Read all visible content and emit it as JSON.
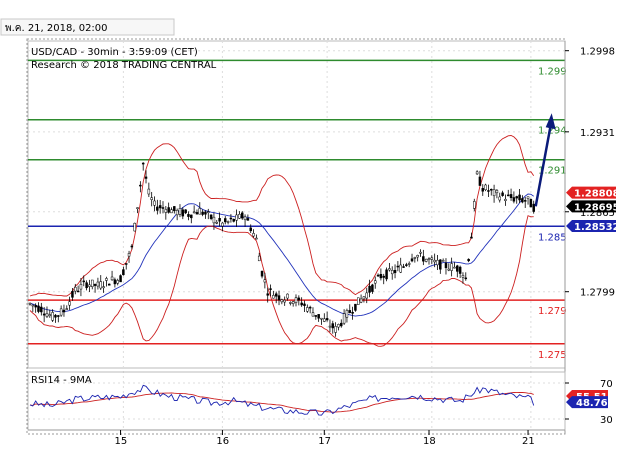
{
  "header": {
    "date_label": "พ.ค. 21, 2018, 02:00"
  },
  "chart_data": {
    "type": "candlestick",
    "title": "USD/CAD - 30min - 3:59:09 (CET)",
    "subtitle": "Research © 2018 TRADING CENTRAL",
    "x_ticks": [
      "15",
      "16",
      "17",
      "18",
      "21"
    ],
    "y_ticks": [
      1.2998,
      1.2931,
      1.2865,
      1.2799
    ],
    "ylim": [
      1.2736,
      1.3006
    ],
    "price_tags": {
      "upper": 1.28808,
      "current": 1.28695,
      "lower": 1.28532
    },
    "levels": [
      {
        "label": "1.299",
        "value": 1.299,
        "color": "#2e8b2e"
      },
      {
        "label": "1.294",
        "value": 1.2941,
        "color": "#2e8b2e"
      },
      {
        "label": "1.291",
        "value": 1.2908,
        "color": "#2e8b2e"
      },
      {
        "label": "1.285",
        "value": 1.2853,
        "color": "#1b24b0"
      },
      {
        "label": "1.279",
        "value": 1.2792,
        "color": "#e32222"
      },
      {
        "label": "1.275",
        "value": 1.2756,
        "color": "#e32222"
      }
    ],
    "series_colors": {
      "candles": "#000000",
      "bollinger": "#cc2020",
      "moving_average": "#2233bb",
      "projection": "#0a1a7a"
    },
    "price_path": [
      [
        0,
        1.2789
      ],
      [
        2,
        1.2785
      ],
      [
        4,
        1.2778
      ],
      [
        6,
        1.2783
      ],
      [
        8,
        1.28
      ],
      [
        10,
        1.2806
      ],
      [
        12,
        1.2804
      ],
      [
        14,
        1.2808
      ],
      [
        16,
        1.281
      ],
      [
        18,
        1.2835
      ],
      [
        19,
        1.287
      ],
      [
        20,
        1.2905
      ],
      [
        21,
        1.288
      ],
      [
        22,
        1.287
      ],
      [
        24,
        1.2868
      ],
      [
        26,
        1.2865
      ],
      [
        28,
        1.2863
      ],
      [
        30,
        1.2866
      ],
      [
        32,
        1.286
      ],
      [
        34,
        1.2855
      ],
      [
        36,
        1.2858
      ],
      [
        38,
        1.2862
      ],
      [
        40,
        1.2842
      ],
      [
        41,
        1.2815
      ],
      [
        42,
        1.28
      ],
      [
        44,
        1.2795
      ],
      [
        46,
        1.2793
      ],
      [
        48,
        1.279
      ],
      [
        50,
        1.2782
      ],
      [
        52,
        1.2775
      ],
      [
        54,
        1.2768
      ],
      [
        56,
        1.278
      ],
      [
        58,
        1.279
      ],
      [
        60,
        1.28
      ],
      [
        62,
        1.2812
      ],
      [
        64,
        1.2815
      ],
      [
        66,
        1.282
      ],
      [
        68,
        1.283
      ],
      [
        70,
        1.2826
      ],
      [
        72,
        1.2822
      ],
      [
        74,
        1.282
      ],
      [
        76,
        1.2818
      ],
      [
        77,
        1.281
      ],
      [
        78,
        1.2845
      ],
      [
        79,
        1.2895
      ],
      [
        80,
        1.2885
      ],
      [
        82,
        1.288
      ],
      [
        84,
        1.2877
      ],
      [
        86,
        1.2876
      ],
      [
        88,
        1.2874
      ],
      [
        89,
        1.2869
      ]
    ],
    "projection": [
      [
        89,
        1.28695
      ],
      [
        92,
        1.2943
      ]
    ],
    "rsi": {
      "title": "RSI14 - 9MA",
      "y_ticks": [
        70,
        30
      ],
      "values": [
        [
          0,
          47
        ],
        [
          4,
          45
        ],
        [
          8,
          52
        ],
        [
          12,
          54
        ],
        [
          16,
          55
        ],
        [
          18,
          60
        ],
        [
          20,
          64
        ],
        [
          24,
          56
        ],
        [
          28,
          52
        ],
        [
          32,
          48
        ],
        [
          36,
          50
        ],
        [
          40,
          44
        ],
        [
          44,
          40
        ],
        [
          48,
          38
        ],
        [
          52,
          36
        ],
        [
          56,
          44
        ],
        [
          60,
          52
        ],
        [
          64,
          55
        ],
        [
          68,
          56
        ],
        [
          72,
          53
        ],
        [
          76,
          50
        ],
        [
          78,
          58
        ],
        [
          80,
          64
        ],
        [
          84,
          57
        ],
        [
          88,
          53
        ],
        [
          89,
          48.761
        ]
      ],
      "tags": {
        "ma": 55.51,
        "rsi": 48.761
      }
    }
  }
}
